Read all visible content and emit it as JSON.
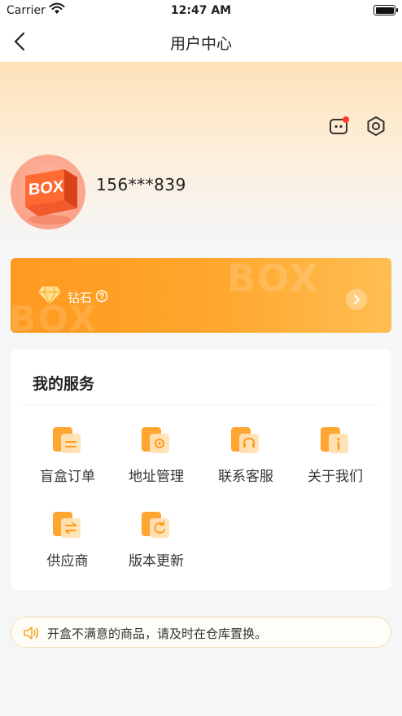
{
  "status_bar": {
    "carrier": "Carrier",
    "time": "12:47 AM"
  },
  "nav": {
    "title": "用户中心",
    "back_icon": "chevron-left-icon"
  },
  "header": {
    "message_icon": "message-robot-icon",
    "settings_icon": "hexagon-settings-icon",
    "avatar_text": "BOX",
    "phone": "156***839"
  },
  "vip": {
    "label": "钻石",
    "watermark_top": "BOX",
    "watermark_bottom": "BOX",
    "icon": "diamond-icon"
  },
  "services": {
    "title": "我的服务",
    "items": [
      {
        "label": "盲盒订单",
        "icon": "order-icon"
      },
      {
        "label": "地址管理",
        "icon": "address-icon"
      },
      {
        "label": "联系客服",
        "icon": "headset-icon"
      },
      {
        "label": "关于我们",
        "icon": "info-icon"
      },
      {
        "label": "供应商",
        "icon": "supplier-icon"
      },
      {
        "label": "版本更新",
        "icon": "refresh-icon"
      }
    ]
  },
  "notice": {
    "text": "开盒不满意的商品，请及时在仓库置换。",
    "icon": "speaker-icon"
  },
  "colors": {
    "accent": "#ff9a1f",
    "accent_light": "#ffbe52",
    "hero_top": "#fde1b8",
    "page_bg": "#f5f6f7",
    "badge": "#ff3b30"
  }
}
